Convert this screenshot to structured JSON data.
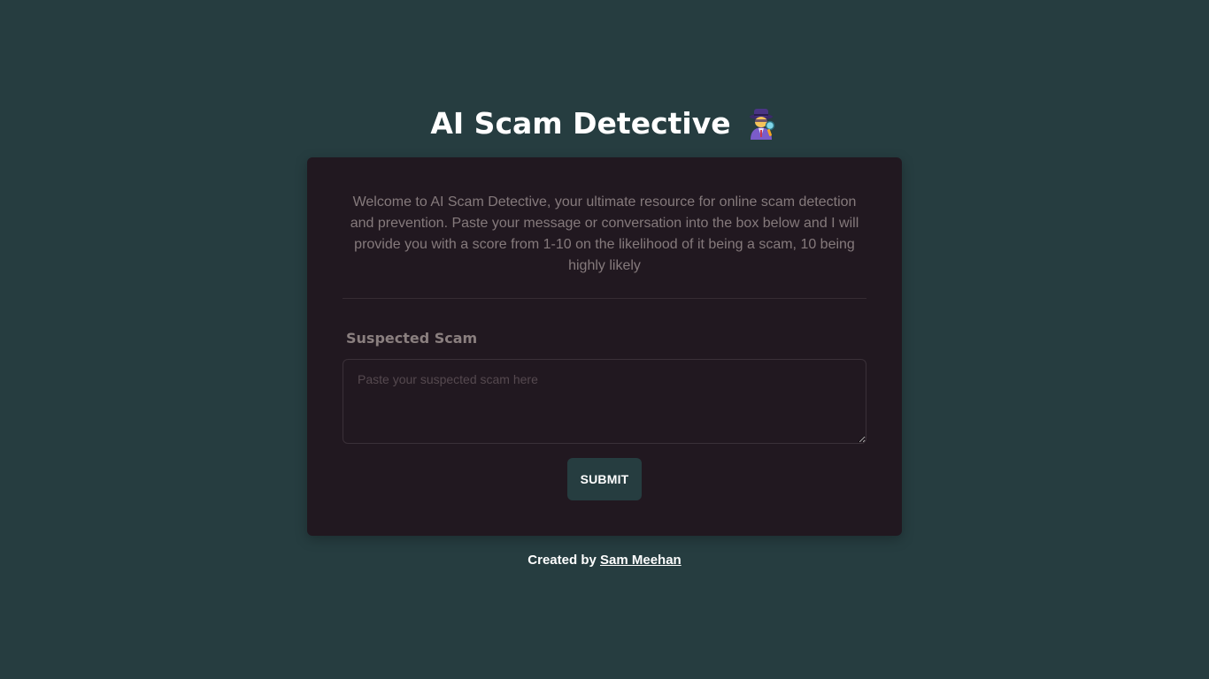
{
  "header": {
    "title": "AI Scam Detective",
    "icon": "detective-icon"
  },
  "card": {
    "intro": "Welcome to AI Scam Detective, your ultimate resource for online scam detection and prevention. Paste your message or conversation into the box below and I will provide you with a score from 1-10 on the likelihood of it being a scam, 10 being highly likely",
    "field_label": "Suspected Scam",
    "input": {
      "value": "",
      "placeholder": "Paste your suspected scam here"
    },
    "submit_label": "SUBMIT"
  },
  "footer": {
    "prefix": "Created by ",
    "author_link": "Sam Meehan"
  },
  "colors": {
    "background": "#263d40",
    "card": "#211820",
    "text_muted": "#857a7c",
    "button": "#263d40"
  }
}
